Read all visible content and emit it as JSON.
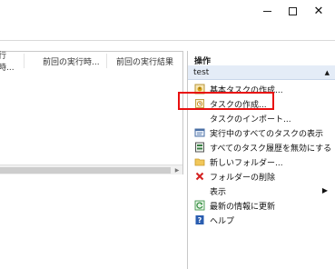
{
  "window": {
    "minimize_icon": "minimize-icon",
    "maximize_icon": "maximize-icon",
    "close_icon": "close-icon"
  },
  "task_list": {
    "columns": [
      "行時...",
      "前回の実行時...",
      "前回の実行結果"
    ]
  },
  "actions_pane": {
    "title": "操作",
    "group": {
      "label": "test",
      "collapse_glyph": "▲"
    },
    "items": [
      {
        "label": "基本タスクの作成...",
        "icon": "wizard-icon",
        "color": "#d4a017"
      },
      {
        "label": "タスクの作成...",
        "icon": "task-icon",
        "color": "#c98a1a"
      },
      {
        "label": "タスクのインポート...",
        "icon": "",
        "color": ""
      },
      {
        "label": "実行中のすべてのタスクの表示",
        "icon": "running-tasks-icon",
        "color": "#4a6fa5"
      },
      {
        "label": "すべてのタスク履歴を無効にする",
        "icon": "history-icon",
        "color": "#3a7d44"
      },
      {
        "label": "新しいフォルダー...",
        "icon": "folder-icon",
        "color": "#e8b84a"
      },
      {
        "label": "フォルダーの削除",
        "icon": "delete-icon",
        "color": "#d42020"
      },
      {
        "label": "表示",
        "icon": "",
        "color": "",
        "submenu": "▶"
      },
      {
        "label": "最新の情報に更新",
        "icon": "refresh-icon",
        "color": "#2e8b3a"
      },
      {
        "label": "ヘルプ",
        "icon": "help-icon",
        "color": "#2a5db0"
      }
    ]
  },
  "highlight_color": "#e81010"
}
